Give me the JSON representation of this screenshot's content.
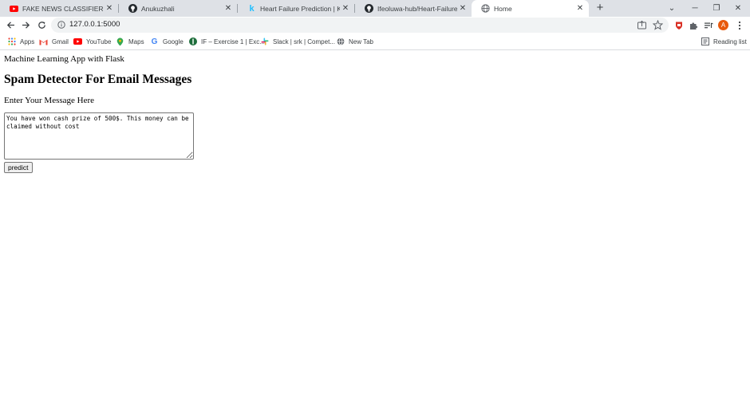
{
  "browser": {
    "tabs": [
      {
        "label": "FAKE NEWS CLASSIFIER WITH M",
        "icon": "youtube-icon",
        "active": false
      },
      {
        "label": "Anukuzhali",
        "icon": "github-icon",
        "active": false
      },
      {
        "label": "Heart Failure Prediction | Kaggle",
        "icon": "kaggle-icon",
        "active": false
      },
      {
        "label": "Ifeoluwa-hub/Heart-Failure-Predi",
        "icon": "github-icon",
        "active": false
      },
      {
        "label": "Home",
        "icon": "globe-icon",
        "active": true
      }
    ],
    "new_tab": "+",
    "window_controls": {
      "minimize": "─",
      "restore": "❐",
      "close": "✕",
      "tab_search": "⌄"
    },
    "url": "127.0.0.1:5000",
    "profile_initial": "A",
    "bookmarks": [
      {
        "label": "Apps",
        "icon": "apps-grid-icon"
      },
      {
        "label": "Gmail",
        "icon": "gmail-icon"
      },
      {
        "label": "YouTube",
        "icon": "youtube-icon"
      },
      {
        "label": "Maps",
        "icon": "maps-pin-icon"
      },
      {
        "label": "Google",
        "icon": "google-icon"
      },
      {
        "label": "IF – Exercise 1 | Exc...",
        "icon": "site-icon"
      },
      {
        "label": "Slack | srk | Compet...",
        "icon": "slack-icon"
      },
      {
        "label": "New Tab",
        "icon": "globe-icon"
      }
    ],
    "reading_list": "Reading list",
    "colors": {
      "tabstrip": "#dee1e6",
      "accent_avatar": "#e8590c",
      "youtube_red": "#ff0000"
    }
  },
  "page": {
    "subtitle": "Machine Learning App with Flask",
    "heading": "Spam Detector For Email Messages",
    "prompt": "Enter Your Message Here",
    "message": "You have won cash prize of 500$. This money can be claimed without cost",
    "button_label": "predict"
  }
}
